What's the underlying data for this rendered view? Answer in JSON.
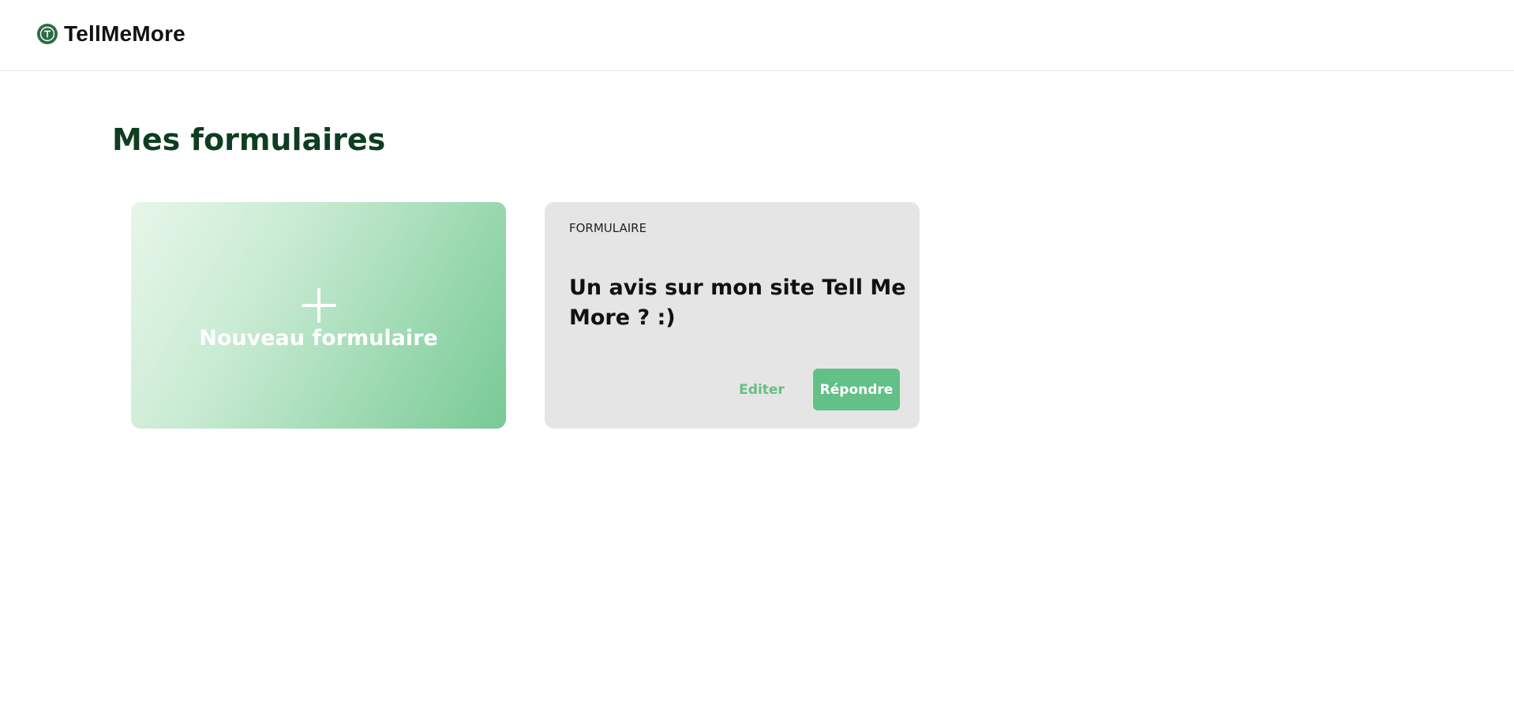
{
  "header": {
    "logo_letter": "T",
    "brand_name": "TellMeMore"
  },
  "main": {
    "title": "Mes formulaires",
    "new_form_card": {
      "icon": "plus-icon",
      "label": "Nouveau formulaire"
    },
    "forms": [
      {
        "type_label": "FORMULAIRE",
        "title": "Un avis sur mon site Tell Me More ? :)",
        "edit_label": "Editer",
        "reply_label": "Répondre"
      }
    ]
  },
  "colors": {
    "brand_dark_green": "#2e6b47",
    "title_green": "#0f3d22",
    "accent_green": "#63c086",
    "card_grey": "#e5e5e5"
  }
}
